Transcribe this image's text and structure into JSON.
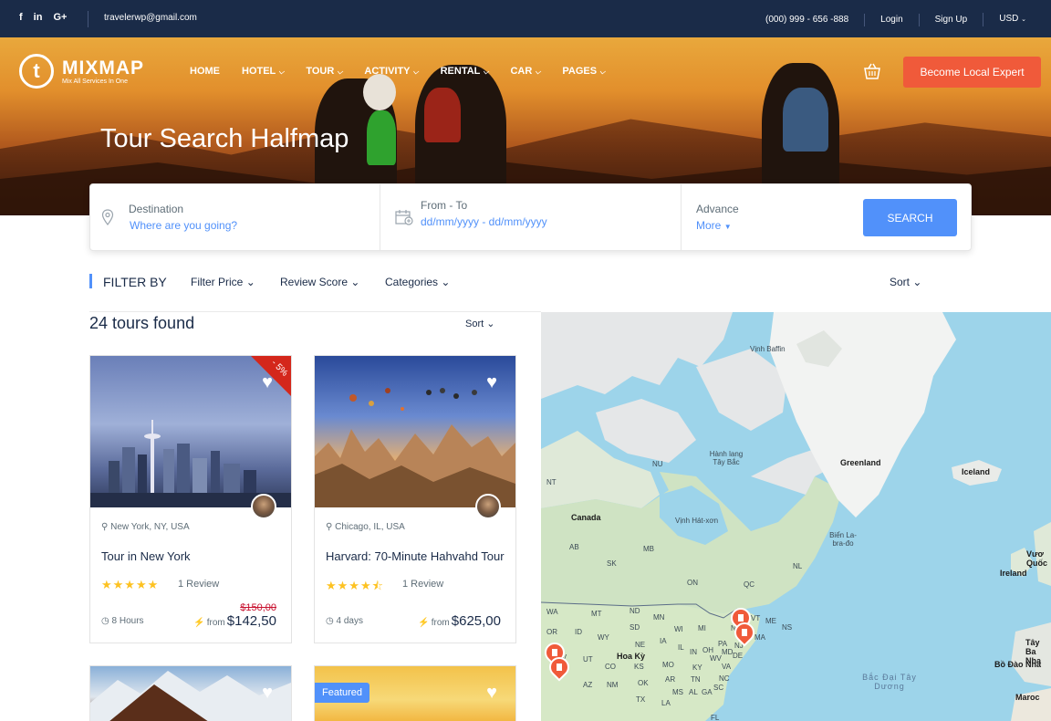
{
  "topbar": {
    "social": [
      "f",
      "in",
      "G+"
    ],
    "email": "travelerwp@gmail.com",
    "phone": "(000) 999 - 656 -888",
    "login": "Login",
    "signup": "Sign Up",
    "currency": "USD"
  },
  "header": {
    "logo_letter": "t",
    "logo_name": "MIXMAP",
    "logo_tagline": "Mix All Services In One",
    "nav": [
      {
        "label": "HOME",
        "has_dropdown": false
      },
      {
        "label": "HOTEL",
        "has_dropdown": true
      },
      {
        "label": "TOUR",
        "has_dropdown": true
      },
      {
        "label": "ACTIVITY",
        "has_dropdown": true
      },
      {
        "label": "RENTAL",
        "has_dropdown": true
      },
      {
        "label": "CAR",
        "has_dropdown": true
      },
      {
        "label": "PAGES",
        "has_dropdown": true
      }
    ],
    "cta": "Become Local Expert"
  },
  "hero": {
    "title": "Tour Search Halfmap"
  },
  "search": {
    "destination_label": "Destination",
    "destination_placeholder": "Where are you going?",
    "date_label": "From - To",
    "date_placeholder": "dd/mm/yyyy - dd/mm/yyyy",
    "advance_label": "Advance",
    "advance_more": "More",
    "button": "SEARCH"
  },
  "filters": {
    "title": "FILTER BY",
    "price": "Filter Price",
    "review": "Review Score",
    "categories": "Categories",
    "sort": "Sort"
  },
  "results": {
    "count_text": "24 tours found",
    "sort": "Sort"
  },
  "tours": [
    {
      "location": "New York, NY, USA",
      "title": "Tour in New York",
      "rating": 5,
      "stars": "★★★★★",
      "reviews": "1 Review",
      "duration": "8 Hours",
      "old_price": "$150,00",
      "from": "from",
      "price": "$142,50",
      "discount": "- 5%"
    },
    {
      "location": "Chicago, IL, USA",
      "title": "Harvard: 70-Minute Hahvahd Tour",
      "rating": 4.5,
      "stars": "★★★★⯪",
      "reviews": "1 Review",
      "duration": "4 days",
      "from": "from",
      "price": "$625,00"
    },
    {
      "badge": ""
    },
    {
      "badge": "Featured"
    }
  ],
  "map": {
    "labels": [
      "Vịnh Baffin",
      "Hành lang Tây Bắc",
      "NU",
      "Greenland",
      "Iceland",
      "Canada",
      "Vịnh Hát-xơn",
      "Biển La-bra-đo",
      "NT",
      "AB",
      "MB",
      "SK",
      "ON",
      "QC",
      "NL",
      "Ireland",
      "Vươ Quốc",
      "Hoa Kỳ",
      "WA",
      "MT",
      "ND",
      "MN",
      "WI",
      "MI",
      "NY",
      "VT",
      "ME",
      "NS",
      "OR",
      "ID",
      "WY",
      "SD",
      "IA",
      "IL",
      "IN",
      "OH",
      "PA",
      "NJ",
      "MA",
      "NV",
      "UT",
      "CO",
      "NE",
      "KS",
      "MO",
      "KY",
      "WV",
      "VA",
      "MD",
      "DE",
      "AZ",
      "NM",
      "OK",
      "AR",
      "TN",
      "NC",
      "TX",
      "MS",
      "AL",
      "GA",
      "SC",
      "LA",
      "FL",
      "Bắc Đại Tây Dương",
      "Tây Ba Nha",
      "Bồ Đào Nha",
      "Maroc"
    ]
  }
}
